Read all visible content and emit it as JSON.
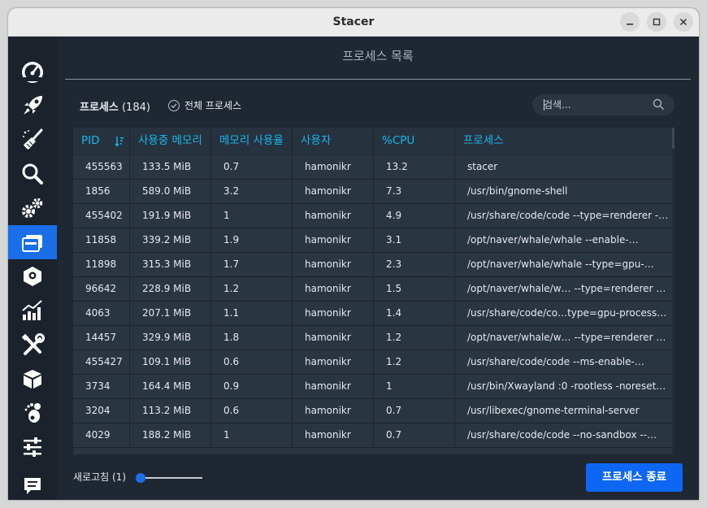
{
  "window": {
    "title": "Stacer"
  },
  "sidebar": {
    "items": [
      {
        "icon": "speedometer-icon",
        "name": "dashboard"
      },
      {
        "icon": "rocket-icon",
        "name": "startup-apps"
      },
      {
        "icon": "broom-icon",
        "name": "system-cleaner"
      },
      {
        "icon": "magnifier-icon",
        "name": "search"
      },
      {
        "icon": "gears-icon",
        "name": "services"
      },
      {
        "icon": "processes-icon",
        "name": "processes",
        "active": true
      },
      {
        "icon": "uninstaller-icon",
        "name": "uninstaller"
      },
      {
        "icon": "chart-icon",
        "name": "resources"
      },
      {
        "icon": "tools-icon",
        "name": "helpers"
      },
      {
        "icon": "package-icon",
        "name": "apt-repository"
      },
      {
        "icon": "gnome-icon",
        "name": "gnome-settings"
      },
      {
        "icon": "sliders-icon",
        "name": "settings"
      },
      {
        "icon": "feedback-icon",
        "name": "feedback"
      }
    ]
  },
  "header": {
    "title": "프로세스 목록"
  },
  "process_count": {
    "label": "프로세스",
    "count": "(184)"
  },
  "all_processes": {
    "label": "전체 프로세스",
    "checked": true
  },
  "search": {
    "placeholder": "검색..."
  },
  "table": {
    "columns": [
      "PID",
      "사용중 메모리",
      "메모리 사용율",
      "사용자",
      "%CPU",
      "프로세스"
    ],
    "rows": [
      [
        "455563",
        "133.5 MiB",
        "0.7",
        "hamonikr",
        "13.2",
        "stacer"
      ],
      [
        "1856",
        "589.0 MiB",
        "3.2",
        "hamonikr",
        "7.3",
        "/usr/bin/gnome-shell"
      ],
      [
        "455402",
        "191.9 MiB",
        "1",
        "hamonikr",
        "4.9",
        "/usr/share/code/code --type=renderer --…"
      ],
      [
        "11858",
        "339.2 MiB",
        "1.9",
        "hamonikr",
        "3.1",
        "/opt/naver/whale/whale --enable-…"
      ],
      [
        "11898",
        "315.3 MiB",
        "1.7",
        "hamonikr",
        "2.3",
        "/opt/naver/whale/whale --type=gpu-…"
      ],
      [
        "96642",
        "228.9 MiB",
        "1.2",
        "hamonikr",
        "1.5",
        "/opt/naver/whale/w… --type=renderer …"
      ],
      [
        "4063",
        "207.1 MiB",
        "1.1",
        "hamonikr",
        "1.4",
        "/usr/share/code/co…type=gpu-process …"
      ],
      [
        "14457",
        "329.9 MiB",
        "1.8",
        "hamonikr",
        "1.2",
        "/opt/naver/whale/w… --type=renderer …"
      ],
      [
        "455427",
        "109.1 MiB",
        "0.6",
        "hamonikr",
        "1.2",
        "/usr/share/code/code --ms-enable-…"
      ],
      [
        "3734",
        "164.4 MiB",
        "0.9",
        "hamonikr",
        "1",
        "/usr/bin/Xwayland :0 -rootless -noreset -…"
      ],
      [
        "3204",
        "113.2 MiB",
        "0.6",
        "hamonikr",
        "0.7",
        "/usr/libexec/gnome-terminal-server"
      ],
      [
        "4029",
        "188.2 MiB",
        "1",
        "hamonikr",
        "0.7",
        "/usr/share/code/code --no-sandbox --…"
      ]
    ]
  },
  "refresh": {
    "label": "새로고침",
    "value": "(1)"
  },
  "kill_button": {
    "label": "프로세스 종료"
  },
  "colors": {
    "accent": "#1a6ee8",
    "header_text": "#19b7e8",
    "bg": "#1f2732"
  }
}
